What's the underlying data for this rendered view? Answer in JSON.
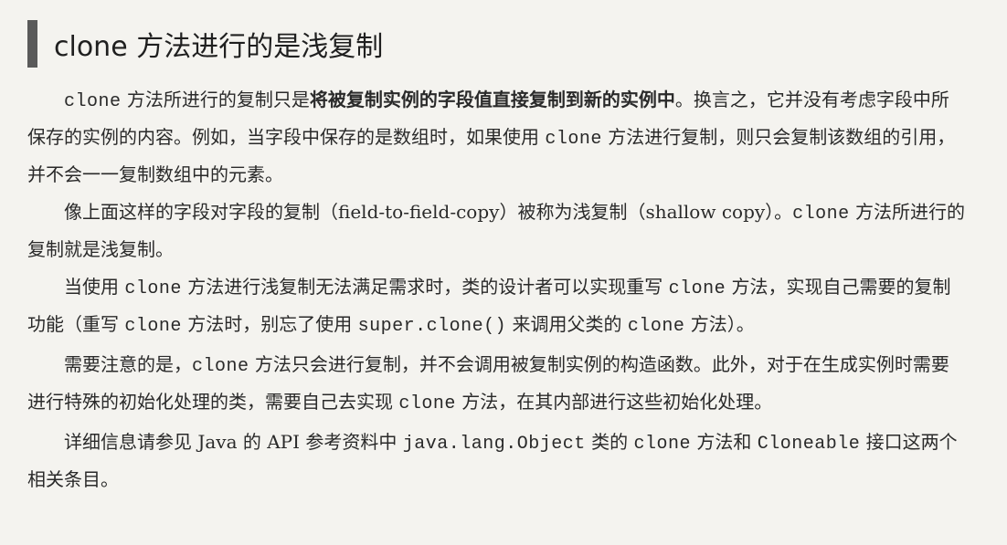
{
  "heading": {
    "title": "clone 方法进行的是浅复制"
  },
  "paragraphs": {
    "p1": {
      "a_code": "clone",
      "b_text": " 方法所进行的复制只是",
      "c_bold": "将被复制实例的字段值直接复制到新的实例中",
      "d_text": "。换言之，它并没有考虑字段中所保存的实例的内容。例如，当字段中保存的是数组时，如果使用 ",
      "e_code": "clone",
      "f_text": " 方法进行复制，则只会复制该数组的引用，并不会一一复制数组中的元素。"
    },
    "p2": {
      "a_text": "像上面这样的字段对字段的复制（field-to-field-copy）被称为浅复制（shallow copy）。",
      "b_code": "clone",
      "c_text": " 方法所进行的复制就是浅复制。"
    },
    "p3": {
      "a_text": "当使用 ",
      "b_code": "clone",
      "c_text": " 方法进行浅复制无法满足需求时，类的设计者可以实现重写 ",
      "d_code": "clone",
      "e_text": " 方法，实现自己需要的复制功能（重写 ",
      "f_code": "clone",
      "g_text": " 方法时，别忘了使用 ",
      "h_code": "super.clone()",
      "i_text": " 来调用父类的 ",
      "j_code": "clone",
      "k_text": " 方法）。"
    },
    "p4": {
      "a_text": "需要注意的是，",
      "b_code": "clone",
      "c_text": " 方法只会进行复制，并不会调用被复制实例的构造函数。此外，对于在生成实例时需要进行特殊的初始化处理的类，需要自己去实现 ",
      "d_code": "clone",
      "e_text": " 方法，在其内部进行这些初始化处理。"
    },
    "p5": {
      "a_text": "详细信息请参见 Java 的 API 参考资料中 ",
      "b_code": "java.lang.Object",
      "c_text": " 类的 ",
      "d_code": "clone",
      "e_text": " 方法和 ",
      "f_code": "Cloneable",
      "g_text": " 接口这两个相关条目。"
    }
  }
}
